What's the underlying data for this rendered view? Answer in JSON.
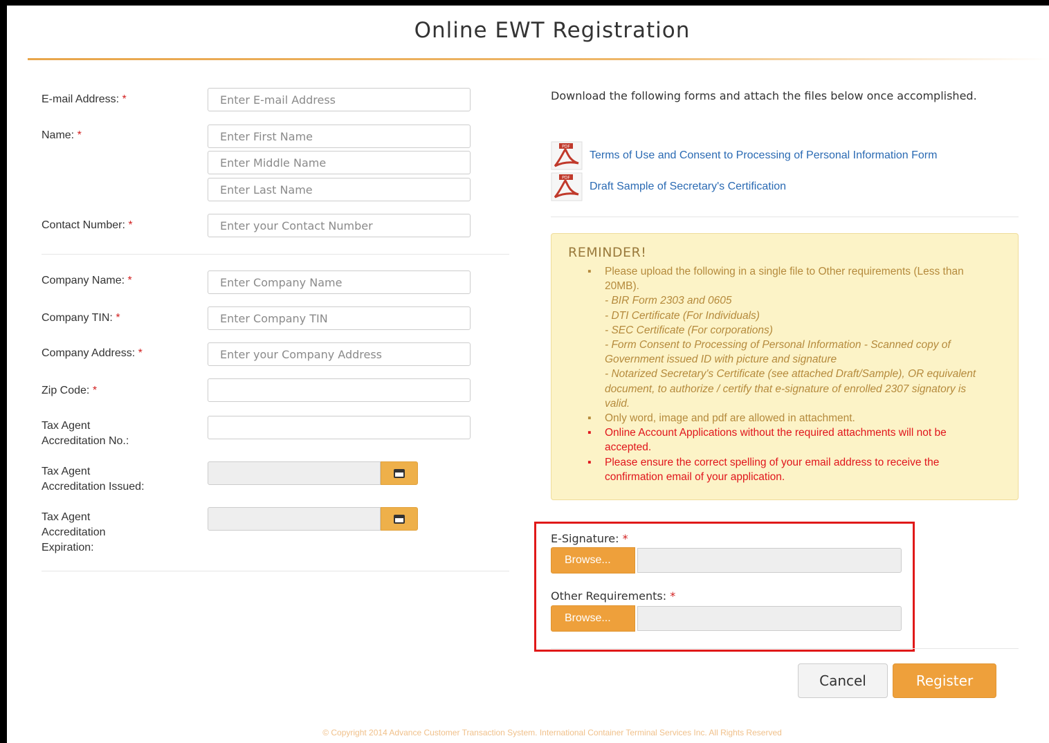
{
  "page": {
    "title": "Online EWT Registration"
  },
  "form": {
    "email": {
      "label": "E-mail Address:",
      "required": "*",
      "placeholder": "Enter E-mail Address"
    },
    "name": {
      "label": "Name:",
      "required": "*",
      "first_placeholder": "Enter First Name",
      "middle_placeholder": "Enter Middle Name",
      "last_placeholder": "Enter Last Name"
    },
    "contact": {
      "label": "Contact Number:",
      "required": "*",
      "placeholder": "Enter your Contact Number"
    },
    "company_name": {
      "label": "Company Name:",
      "required": "*",
      "placeholder": "Enter Company Name"
    },
    "company_tin": {
      "label": "Company TIN:",
      "required": "*",
      "placeholder": "Enter Company TIN"
    },
    "company_address": {
      "label": "Company Address:",
      "required": "*",
      "placeholder": "Enter your Company Address"
    },
    "zip": {
      "label": "Zip Code:",
      "required": "*",
      "placeholder": ""
    },
    "tax_agent_no": {
      "label_line1": "Tax Agent",
      "label_line2": "Accreditation No.:"
    },
    "tax_agent_issued": {
      "label_line1": "Tax Agent",
      "label_line2": "Accreditation Issued:"
    },
    "tax_agent_expiration": {
      "label_line1": "Tax Agent",
      "label_line2": "Accreditation",
      "label_line3": "Expiration:"
    }
  },
  "downloads": {
    "intro": "Download the following forms and attach the files below once accomplished.",
    "items": [
      {
        "label": "Terms of Use and Consent to Processing of Personal Information Form",
        "icon": "pdf-icon"
      },
      {
        "label": "Draft Sample of Secretary's Certification",
        "icon": "pdf-icon"
      }
    ]
  },
  "reminder": {
    "title": "REMINDER!",
    "items": [
      {
        "text": "Please upload the following in a single file to Other requirements (Less than 20MB).",
        "sub": [
          "- BIR Form 2303 and 0605",
          "- DTI Certificate (For Individuals)",
          "- SEC Certificate (For corporations)",
          "- Form Consent to Processing of Personal Information - Scanned copy of Government issued ID with picture and signature",
          "- Notarized Secretary's Certificate (see attached Draft/Sample), OR equivalent document, to authorize / certify that e-signature of enrolled 2307 signatory is valid."
        ]
      },
      {
        "text": "Only word, image and pdf are allowed in attachment."
      },
      {
        "text": "Online Account Applications without the required attachments will not be accepted."
      },
      {
        "text": "Please ensure the correct spelling of your email address to receive the confirmation email of your application."
      }
    ]
  },
  "uploads": {
    "esignature": {
      "label": "E-Signature:",
      "required": "*",
      "button": "Browse..."
    },
    "other": {
      "label": "Other Requirements:",
      "required": "*",
      "button": "Browse..."
    }
  },
  "actions": {
    "cancel": "Cancel",
    "register": "Register"
  },
  "footer": "© Copyright 2014 Advance Customer Transaction System. International Container Terminal Services Inc. All Rights Reserved",
  "colors": {
    "accent": "#eea03b",
    "required": "#d21f1f",
    "link": "#2a6ab3",
    "highlight_border": "#e01919"
  }
}
